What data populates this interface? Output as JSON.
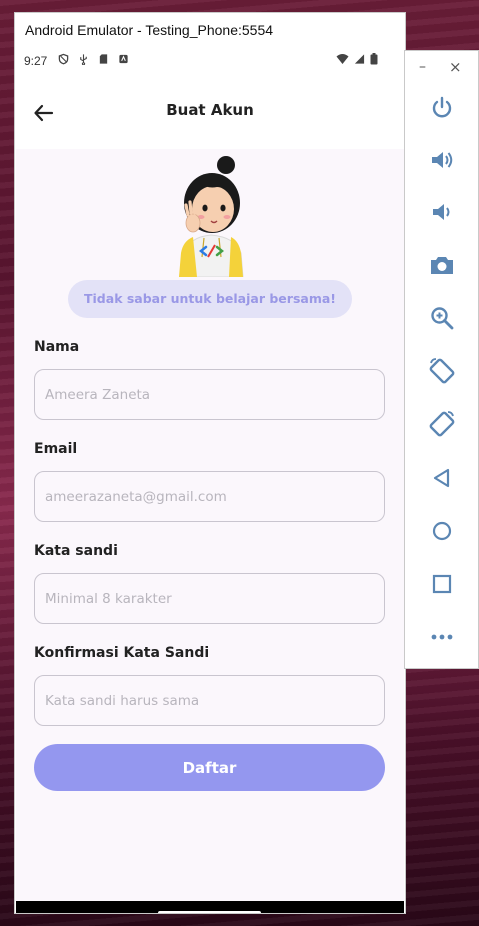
{
  "emulator": {
    "title": "Android Emulator - Testing_Phone:5554"
  },
  "statusbar": {
    "time": "9:27",
    "left_icons": [
      "shield-icon",
      "usb-icon",
      "sd-card-icon",
      "notification-icon"
    ],
    "right_icons": [
      "wifi-icon",
      "signal-icon",
      "battery-icon"
    ]
  },
  "appbar": {
    "title": "Buat Akun",
    "back_icon": "arrow-left-icon"
  },
  "hero": {
    "tagline": "Tidak sabar untuk belajar bersama!"
  },
  "form": {
    "name": {
      "label": "Nama",
      "placeholder": "Ameera Zaneta",
      "value": ""
    },
    "email": {
      "label": "Email",
      "placeholder": "ameerazaneta@gmail.com",
      "value": ""
    },
    "password": {
      "label": "Kata sandi",
      "placeholder": "Minimal 8 karakter",
      "value": ""
    },
    "confirm": {
      "label": "Konfirmasi Kata Sandi",
      "placeholder": "Kata sandi harus sama",
      "value": ""
    },
    "submit_label": "Daftar"
  },
  "toolbar": {
    "minimize": "–",
    "close": "×",
    "buttons": [
      "power-icon",
      "volume-up-icon",
      "volume-down-icon",
      "camera-icon",
      "zoom-icon",
      "rotate-left-icon",
      "rotate-right-icon",
      "back-icon",
      "home-icon",
      "overview-icon",
      "more-icon"
    ]
  },
  "colors": {
    "accent": "#9497ef",
    "pill_bg": "#e3e2f7",
    "pill_text": "#9a98e6",
    "toolbar_icon": "#5b86b3"
  }
}
